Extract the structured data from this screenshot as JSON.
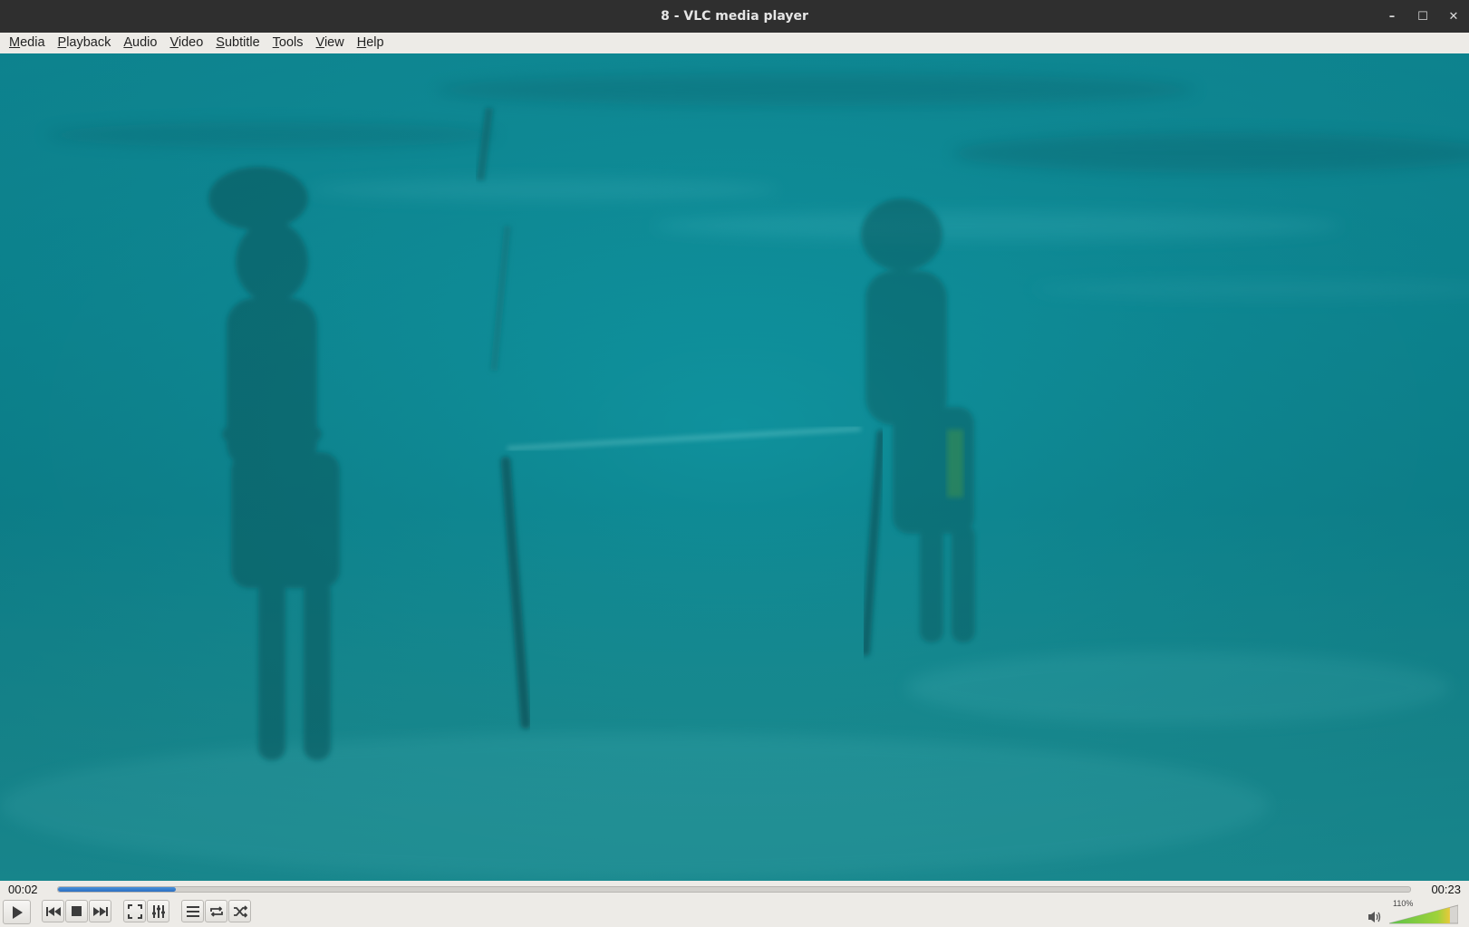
{
  "window": {
    "title": "8 - VLC media player",
    "controls": {
      "minimize": "–",
      "maximize": "☐",
      "close": "✕"
    }
  },
  "menu": [
    {
      "mnemonic": "M",
      "rest": "edia"
    },
    {
      "mnemonic": "P",
      "rest": "layback"
    },
    {
      "mnemonic": "A",
      "rest": "udio"
    },
    {
      "mnemonic": "V",
      "rest": "ideo"
    },
    {
      "mnemonic": "S",
      "rest": "ubtitle"
    },
    {
      "mnemonic": "T",
      "rest": "ools"
    },
    {
      "mnemonic": "V",
      "rest": "iew"
    },
    {
      "mnemonic": "H",
      "rest": "elp"
    }
  ],
  "playback": {
    "elapsed": "00:02",
    "total": "00:23",
    "progress_fraction": 0.087
  },
  "volume": {
    "label": "110%",
    "level_fraction": 0.88
  },
  "colors": {
    "water": "#119aa6",
    "accent": "#2a6fc2",
    "titlebar": "#2f2f2f"
  },
  "icons": {
    "play": "play-icon",
    "previous": "previous-icon",
    "stop": "stop-icon",
    "next": "next-icon",
    "fullscreen": "fullscreen-icon",
    "extended": "extended-settings-icon",
    "playlist": "playlist-icon",
    "loop": "loop-icon",
    "random": "random-icon",
    "speaker": "speaker-icon"
  }
}
